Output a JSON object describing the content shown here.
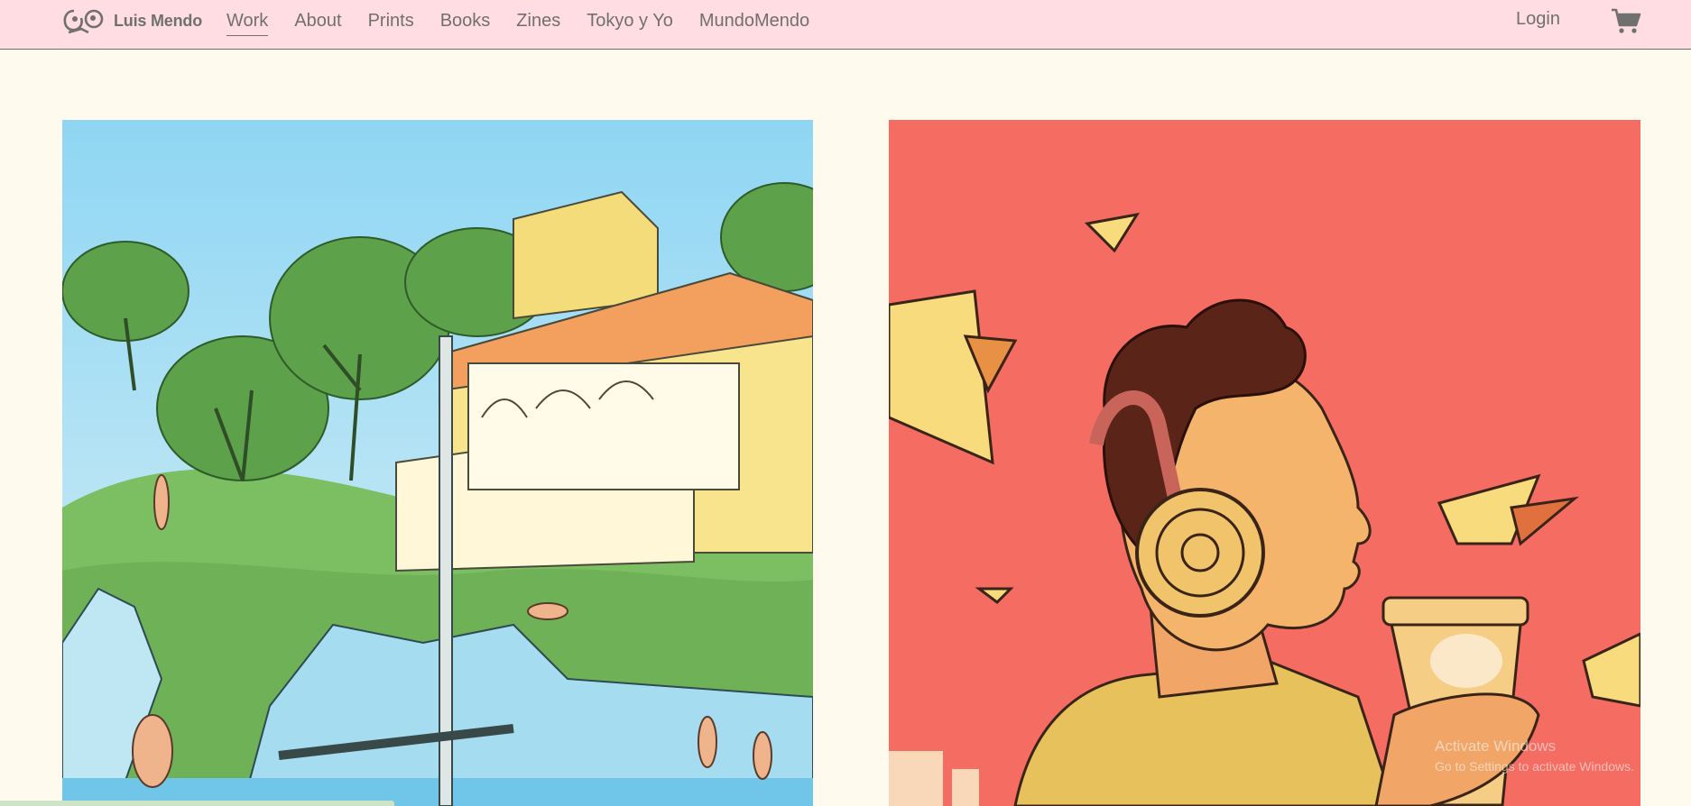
{
  "brand": {
    "name": "Luis Mendo"
  },
  "nav": {
    "items": [
      {
        "label": "Work",
        "active": true
      },
      {
        "label": "About"
      },
      {
        "label": "Prints"
      },
      {
        "label": "Books"
      },
      {
        "label": "Zines"
      },
      {
        "label": "Tokyo y Yo"
      },
      {
        "label": "MundoMendo"
      }
    ]
  },
  "header": {
    "login_label": "Login",
    "cart_icon": "cart-icon"
  },
  "gallery": {
    "items": [
      {
        "subject": "villa on a green hillside with swimmers",
        "colors": [
          "#9ad9f0",
          "#79b861",
          "#f4dc7a"
        ]
      },
      {
        "subject": "person with headphones holding a coffee cup",
        "colors": [
          "#f46a62",
          "#f3c06a"
        ]
      }
    ]
  },
  "overlay": {
    "line1": "Activate Windows",
    "line2": "Go to Settings to activate Windows."
  },
  "colors": {
    "topbar": "#ffdde2",
    "page": "#fffaee",
    "text": "#707070"
  }
}
